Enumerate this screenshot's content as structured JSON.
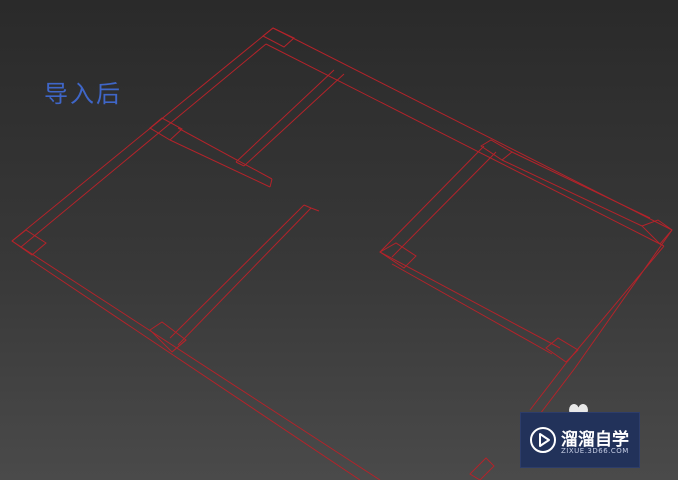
{
  "viewport": {
    "caption": "导入后",
    "caption_color": "#3f66c8",
    "background_top": "#2a2a2a",
    "background_bottom": "#4a4a4a",
    "wireframe_color": "#b3232a"
  },
  "watermark": {
    "brand_name": "溜溜自学",
    "brand_url": "ZIXUE.3D66.COM",
    "logo_icon": "play-icon",
    "background_color": "#22325a"
  }
}
